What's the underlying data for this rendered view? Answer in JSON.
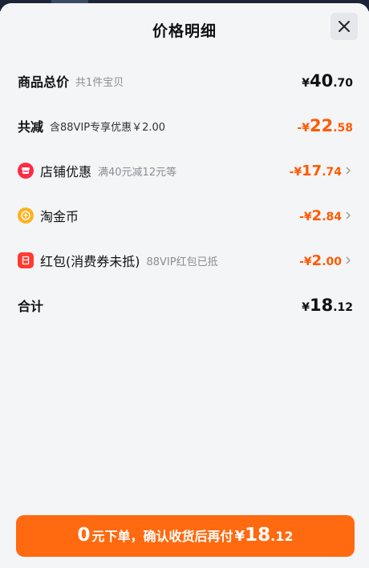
{
  "header": {
    "title": "价格明细"
  },
  "rows": {
    "total": {
      "label": "商品总价",
      "sub": "共1件宝贝",
      "currency": "¥",
      "int": "40",
      "dec": ".70"
    },
    "reduce": {
      "label": "共减",
      "sub": "含88VIP专享优惠￥2.00",
      "currency": "-¥",
      "int": "22",
      "dec": ".58"
    },
    "shop": {
      "label": "店铺优惠",
      "sub": "满40元减12元等",
      "currency": "-¥",
      "int": "17",
      "dec": ".74"
    },
    "coin": {
      "label": "淘金币",
      "currency": "-¥",
      "int": "2",
      "dec": ".84"
    },
    "redpacket": {
      "label": "红包(消费券未抵)",
      "sub": "88VIP红包已抵",
      "currency": "-¥",
      "int": "2",
      "dec": ".00"
    },
    "sum": {
      "label": "合计",
      "currency": "¥",
      "int": "18",
      "dec": ".12"
    }
  },
  "footer": {
    "zero": "0",
    "text": "元下单，确认收货后再付",
    "currency": "¥",
    "int": "18",
    "dec": ".12"
  },
  "colors": {
    "accent": "#ff5a00",
    "button": "#ff6a10"
  },
  "icons": [
    "close-icon",
    "shop-icon",
    "coin-icon",
    "red-packet-icon",
    "chevron-right-icon"
  ]
}
